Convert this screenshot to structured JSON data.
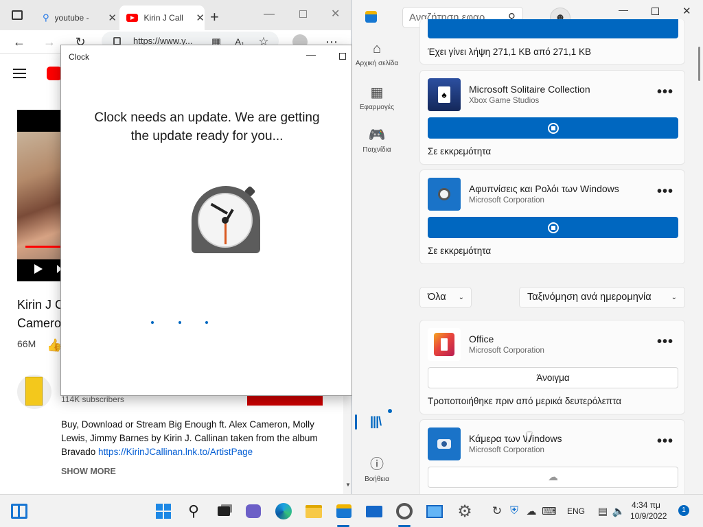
{
  "browser": {
    "tabs": [
      {
        "label": "youtube -",
        "close": "✕"
      },
      {
        "label": "Kirin J Call",
        "close": "✕"
      }
    ],
    "url": "https://www.y...",
    "yt": {
      "video_title_line1": "Kirin J C",
      "video_title_line2": "Camero",
      "views": "66M",
      "subscribers": "114K subscribers",
      "description": "Buy, Download or Stream Big Enough ft. Alex Cameron, Molly Lewis, Jimmy Barnes by Kirin J. Callinan taken from the album Bravado ",
      "link": "https://KirinJCallinan.lnk.to/ArtistPage",
      "show_more": "SHOW MORE"
    }
  },
  "clock": {
    "title": "Clock",
    "message": "Clock needs an update. We are getting the update ready for you..."
  },
  "store": {
    "search_placeholder": "Αναζήτηση εφαρ...",
    "nav": [
      {
        "label": "Αρχική σελίδα",
        "icon": "home-icon"
      },
      {
        "label": "Εφαρμογές",
        "icon": "apps-icon"
      },
      {
        "label": "Παιχνίδια",
        "icon": "gamepad-icon"
      },
      {
        "label": "Βοήθεια",
        "icon": "help-icon"
      }
    ],
    "download_status": "Έχει γίνει λήψη 271,1 KB από 271,1 KB",
    "pending": [
      {
        "name": "Microsoft Solitaire Collection",
        "publisher": "Xbox Game Studios",
        "status": "Σε εκκρεμότητα"
      },
      {
        "name": "Αφυπνίσεις και Ρολόι των Windows",
        "publisher": "Microsoft Corporation",
        "status": "Σε εκκρεμότητα"
      }
    ],
    "filter": "Όλα",
    "sort": "Ταξινόμηση ανά ημερομηνία",
    "library": [
      {
        "name": "Office",
        "publisher": "Microsoft Corporation",
        "button": "Άνοιγμα",
        "status": "Τροποποιήθηκε πριν από μερικά δευτερόλεπτα"
      },
      {
        "name": "Κάμερα των Windows",
        "publisher": "Microsoft Corporation"
      }
    ]
  },
  "taskbar": {
    "lang": "ENG",
    "time": "4:34 πμ",
    "date": "10/9/2022",
    "notifications": "1"
  }
}
